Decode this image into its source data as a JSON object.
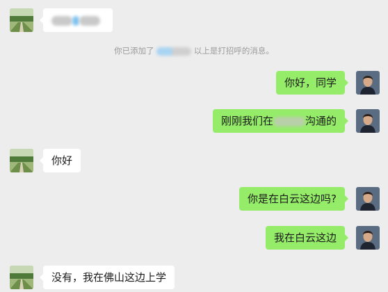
{
  "colors": {
    "background": "#ededed",
    "bubble_left": "#ffffff",
    "bubble_right": "#95ec69",
    "text": "#1a1a1a",
    "system_text": "#9a9a9a"
  },
  "system_message": {
    "prefix": "你已添加了",
    "suffix": "以上是打招呼的消息。"
  },
  "messages": [
    {
      "side": "left",
      "text": "",
      "redacted": true,
      "avatar": "landscape-avatar"
    },
    {
      "side": "right",
      "text": "你好，同学",
      "avatar": "man-avatar"
    },
    {
      "side": "right",
      "text_before": "刚刚我们在",
      "text_after": "沟通的",
      "avatar": "man-avatar"
    },
    {
      "side": "left",
      "text": "你好",
      "avatar": "landscape-avatar"
    },
    {
      "side": "right",
      "text": "你是在白云这边吗?",
      "avatar": "man-avatar"
    },
    {
      "side": "right",
      "text": "我在白云这边",
      "avatar": "man-avatar"
    },
    {
      "side": "left",
      "text": "没有，我在佛山这边上学",
      "avatar": "landscape-avatar"
    }
  ]
}
